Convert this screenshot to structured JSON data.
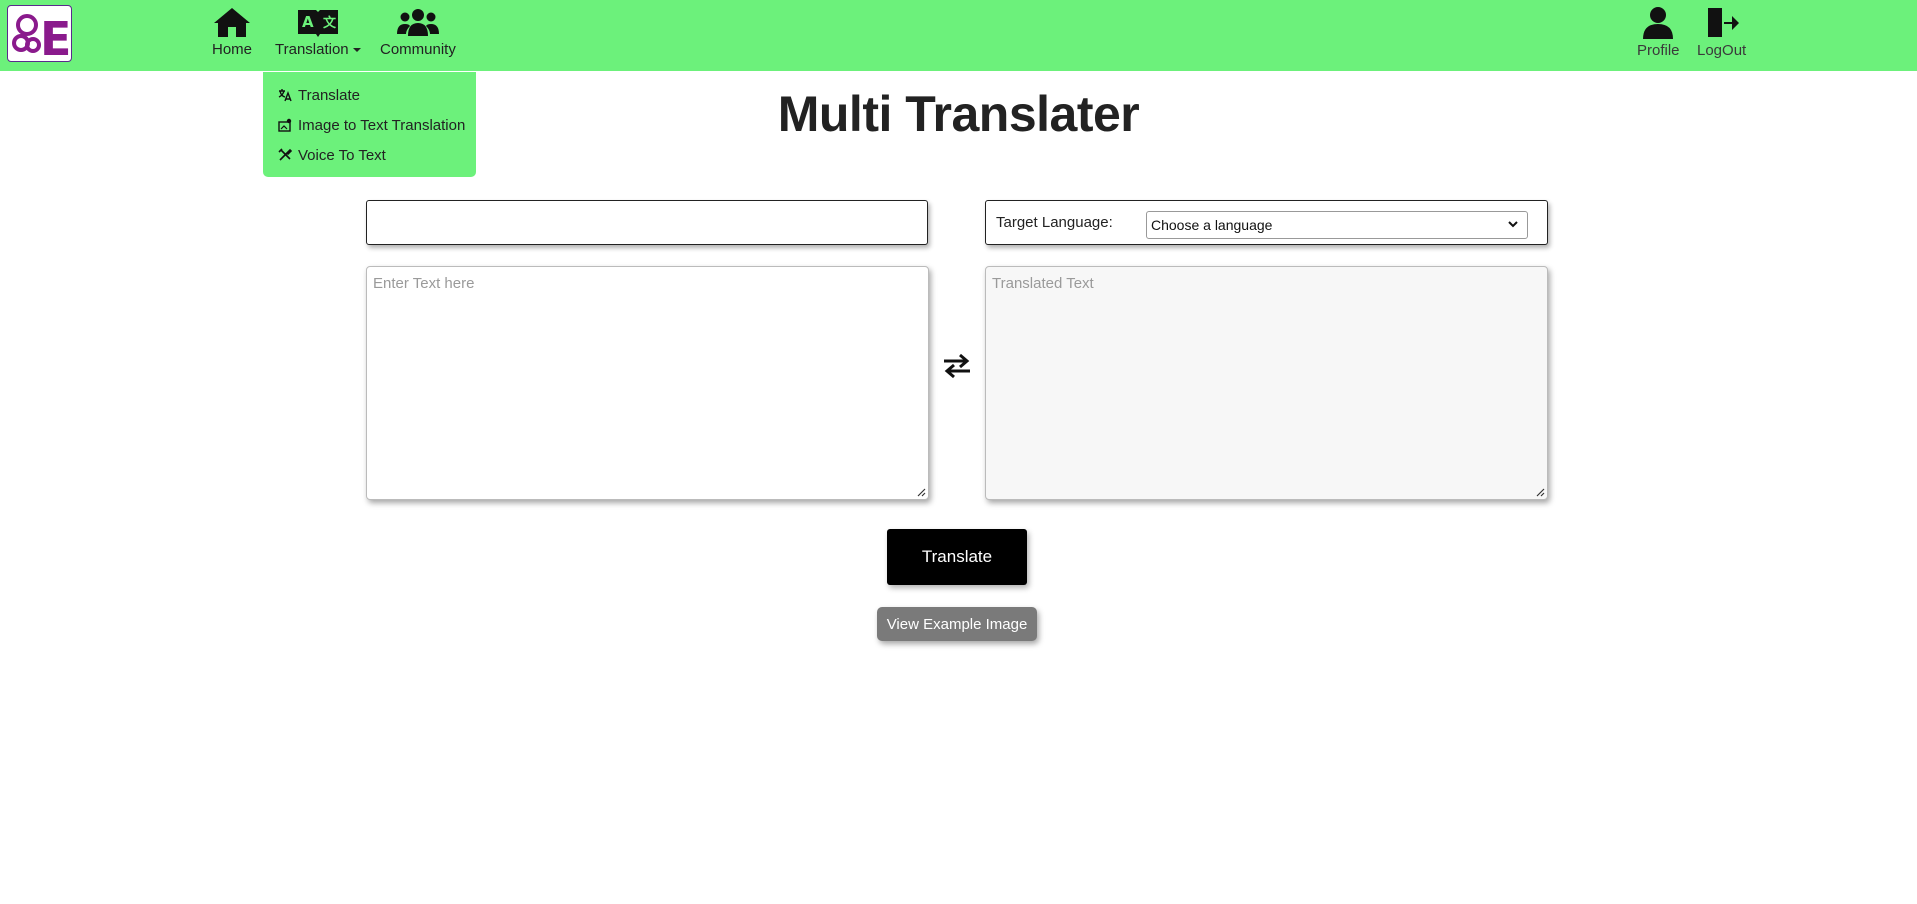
{
  "logo": {
    "text": "E"
  },
  "nav": {
    "home": "Home",
    "translation": "Translation",
    "community": "Community",
    "profile": "Profile",
    "logout": "LogOut"
  },
  "dropdown": {
    "items": [
      {
        "label": "Translate",
        "icon": "translate-icon"
      },
      {
        "label": "Image to Text Translation",
        "icon": "image-text-icon"
      },
      {
        "label": "Voice To Text",
        "icon": "tools-icon"
      }
    ]
  },
  "page": {
    "title": "Multi Translater"
  },
  "target": {
    "label": "Target Language:",
    "selected": "Choose a language"
  },
  "input": {
    "placeholder": "Enter Text here",
    "value": ""
  },
  "output": {
    "placeholder": "Translated Text",
    "value": ""
  },
  "buttons": {
    "translate": "Translate",
    "view_example": "View Example Image"
  },
  "colors": {
    "navbar": "#6cf17b",
    "logo_purple": "#8a1a8c",
    "button": "#000000",
    "secondary_button": "#7a7a7a"
  }
}
